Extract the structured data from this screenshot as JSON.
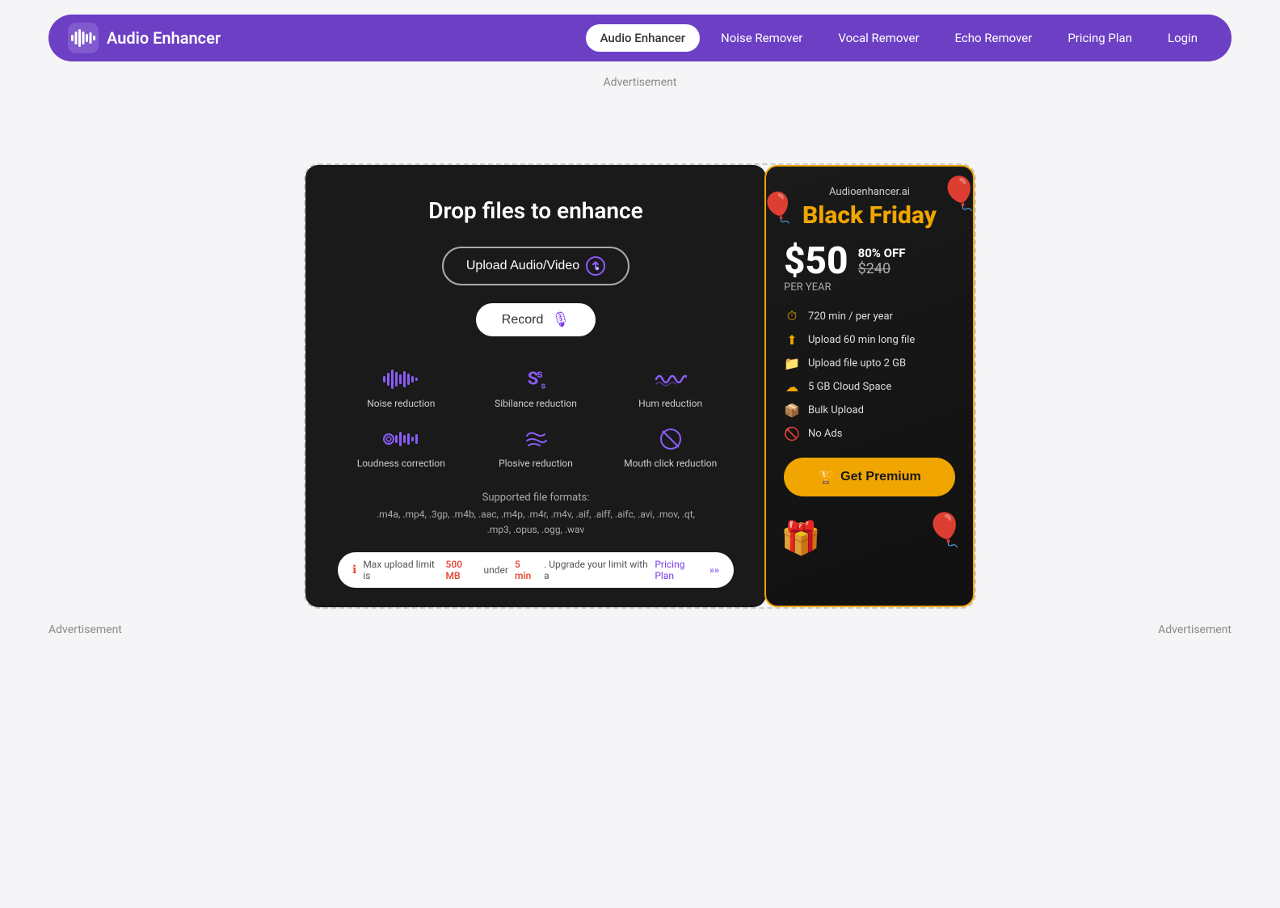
{
  "navbar": {
    "brand": "Audio Enhancer",
    "links": [
      {
        "label": "Audio Enhancer",
        "active": true
      },
      {
        "label": "Noise Remover",
        "active": false
      },
      {
        "label": "Vocal Remover",
        "active": false
      },
      {
        "label": "Echo Remover",
        "active": false
      },
      {
        "label": "Pricing Plan",
        "active": false
      },
      {
        "label": "Login",
        "active": false
      }
    ]
  },
  "ads": {
    "top_label": "Advertisement",
    "bottom_left": "Advertisement",
    "bottom_right": "Advertisement"
  },
  "upload_card": {
    "drop_title": "Drop files to enhance",
    "upload_btn": "Upload Audio/Video",
    "record_btn": "Record",
    "features": [
      {
        "icon": "🎚",
        "label": "Noise reduction"
      },
      {
        "icon": "Ss",
        "label": "Sibilance reduction"
      },
      {
        "icon": "〰",
        "label": "Hum reduction"
      },
      {
        "icon": "◎",
        "label": "Loudness correction"
      },
      {
        "icon": "💨",
        "label": "Plosive reduction"
      },
      {
        "icon": "⊘",
        "label": "Mouth click reduction"
      }
    ],
    "formats_title": "Supported file formats:",
    "formats_list": ".m4a, .mp4, .3gp, .m4b, .aac, .m4p, .m4r, .m4v, .aif, .aiff, .aifc, .avi, .mov, .qt,",
    "formats_list2": ".mp3, .opus, .ogg, .wav",
    "limit_text_1": "Max upload limit is ",
    "limit_highlight1": "500 MB",
    "limit_text_2": " under ",
    "limit_highlight2": "5 min",
    "limit_text_3": ". Upgrade your limit with a ",
    "limit_link": "Pricing Plan"
  },
  "premium_card": {
    "site": "Audioenhancer.ai",
    "black_friday": "Black Friday",
    "price": "$50",
    "off": "80% OFF",
    "old_price": "$240",
    "per_year": "PER YEAR",
    "features": [
      "720 min / per year",
      "Upload 60 min long file",
      "Upload file upto 2 GB",
      "5 GB Cloud Space",
      "Bulk Upload",
      "No Ads"
    ],
    "cta": "Get Premium"
  }
}
